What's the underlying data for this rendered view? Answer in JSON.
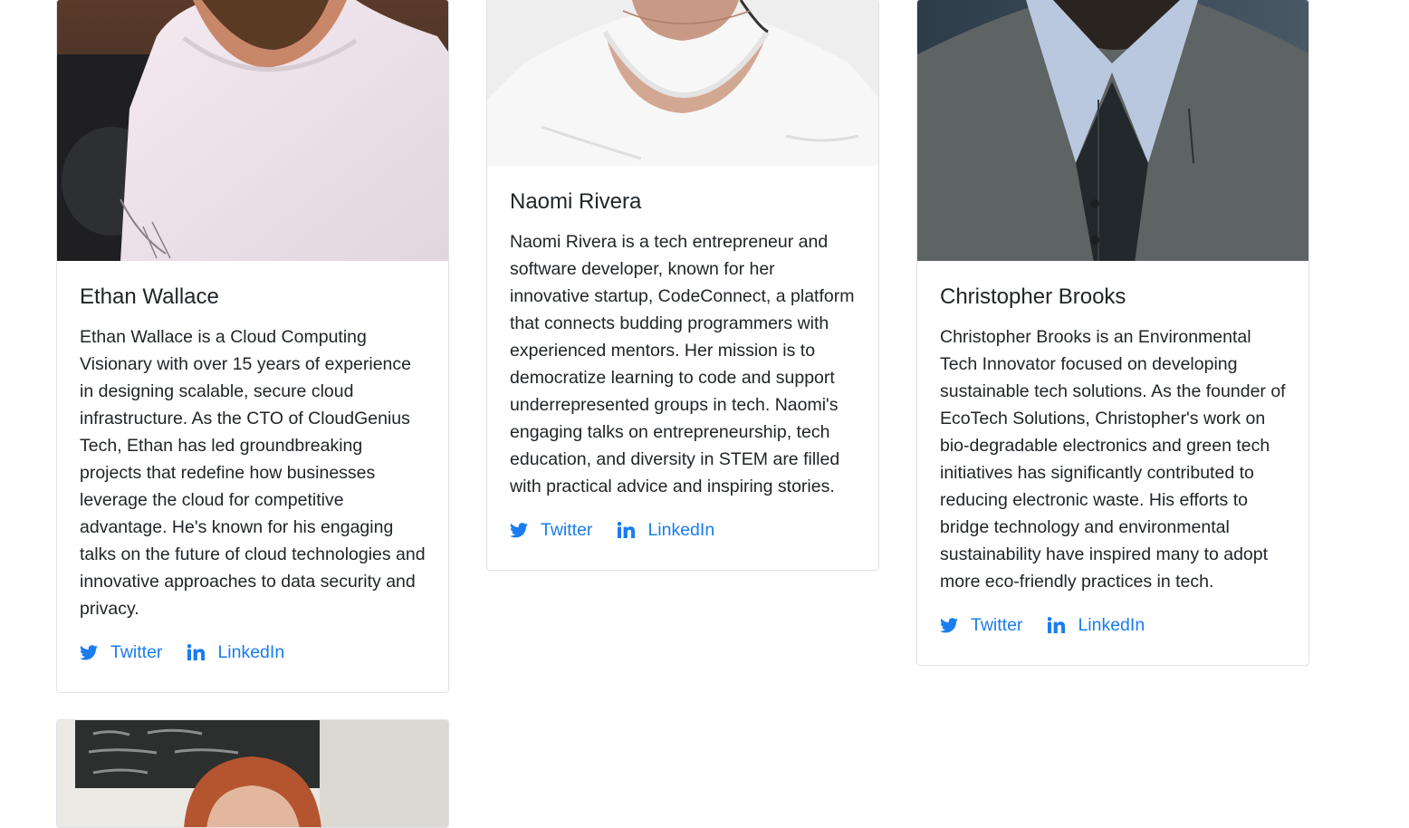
{
  "team": [
    {
      "name": "Ethan Wallace",
      "bio": "Ethan Wallace is a Cloud Computing Visionary with over 15 years of experience in designing scalable, secure cloud infrastructure. As the CTO of CloudGenius Tech, Ethan has led groundbreaking projects that redefine how businesses leverage the cloud for competitive advantage. He's known for his engaging talks on the future of cloud technologies and innovative approaches to data security and privacy.",
      "twitter_label": "Twitter",
      "linkedin_label": "LinkedIn"
    },
    {
      "name": "Naomi Rivera",
      "bio": "Naomi Rivera is a tech entrepreneur and software developer, known for her innovative startup, CodeConnect, a platform that connects budding programmers with experienced mentors. Her mission is to democratize learning to code and support underrepresented groups in tech. Naomi's engaging talks on entrepreneurship, tech education, and diversity in STEM are filled with practical advice and inspiring stories.",
      "twitter_label": "Twitter",
      "linkedin_label": "LinkedIn"
    },
    {
      "name": "Christopher Brooks",
      "bio": "Christopher Brooks is an Environmental Tech Innovator focused on developing sustainable tech solutions. As the founder of EcoTech Solutions, Christopher's work on bio-degradable electronics and green tech initiatives has significantly contributed to reducing electronic waste. His efforts to bridge technology and environmental sustainability have inspired many to adopt more eco-friendly practices in tech.",
      "twitter_label": "Twitter",
      "linkedin_label": "LinkedIn"
    }
  ],
  "colors": {
    "link": "#1a7cf0",
    "text": "#212529",
    "border": "#dee2e6"
  },
  "icons": {
    "twitter": "twitter-icon",
    "linkedin": "linkedin-icon"
  }
}
